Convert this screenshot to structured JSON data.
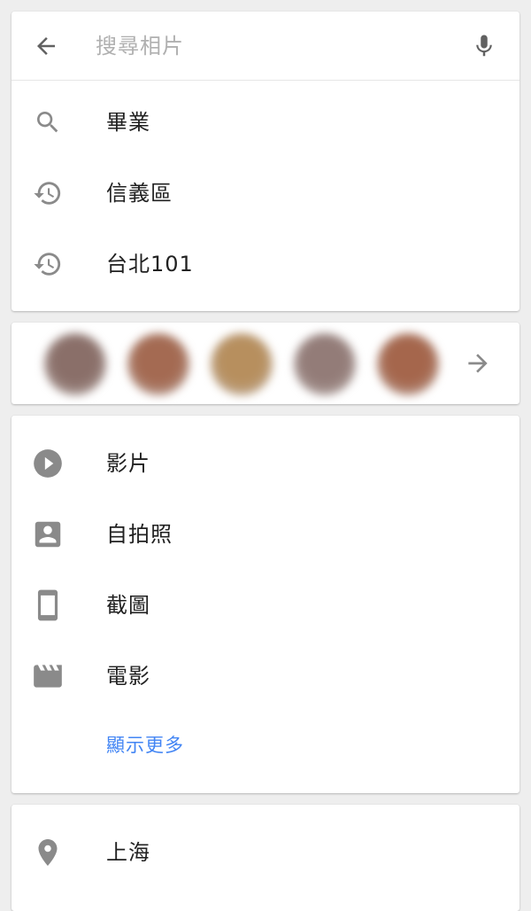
{
  "search": {
    "placeholder": "搜尋相片",
    "back_icon": "arrow-back-icon",
    "voice_icon": "microphone-icon"
  },
  "suggestions": [
    {
      "icon": "search-icon",
      "label": "畢業"
    },
    {
      "icon": "history-icon",
      "label": "信義區"
    },
    {
      "icon": "history-icon",
      "label": "台北101"
    }
  ],
  "people": {
    "faces": [
      "#8a6f69",
      "#a46a52",
      "#b78f5e",
      "#937c78",
      "#a5664c"
    ],
    "more_icon": "arrow-forward-icon"
  },
  "categories": {
    "items": [
      {
        "icon": "play-circle-icon",
        "label": "影片"
      },
      {
        "icon": "portrait-icon",
        "label": "自拍照"
      },
      {
        "icon": "phone-icon",
        "label": "截圖"
      },
      {
        "icon": "movie-clapper-icon",
        "label": "電影"
      }
    ],
    "show_more": "顯示更多"
  },
  "places": [
    {
      "icon": "location-pin-icon",
      "label": "上海"
    }
  ],
  "colors": {
    "background": "#eeeeee",
    "card": "#ffffff",
    "icon": "#8a8a8a",
    "text": "#212121",
    "link": "#4285f4"
  }
}
